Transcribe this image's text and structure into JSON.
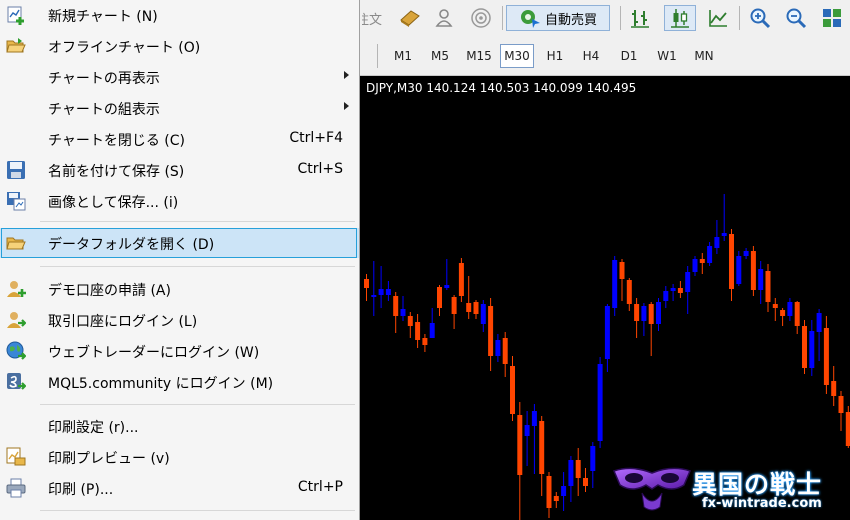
{
  "toolbar": {
    "partial_label": "注文",
    "auto_trade_label": "自動売買"
  },
  "timeframes": [
    {
      "label": "M1"
    },
    {
      "label": "M5"
    },
    {
      "label": "M15"
    },
    {
      "label": "M30",
      "active": true
    },
    {
      "label": "H1"
    },
    {
      "label": "H4"
    },
    {
      "label": "D1"
    },
    {
      "label": "W1"
    },
    {
      "label": "MN"
    }
  ],
  "chart": {
    "header_text": "DJPY,M30  140.124 140.503 140.099 140.495",
    "bull_color": "#0000ff",
    "bear_color": "#ff4500",
    "background": "#000000"
  },
  "chart_data": {
    "type": "candlestick",
    "symbol_fragment": "DJPY",
    "timeframe": "M30",
    "ohlc_last": {
      "open": 140.124,
      "high": 140.503,
      "low": 140.099,
      "close": 140.495
    },
    "candles": [
      [
        203,
        212,
        198,
        225
      ],
      [
        221,
        219,
        185,
        240
      ],
      [
        219,
        213,
        190,
        232
      ],
      [
        219,
        213,
        205,
        225
      ],
      [
        220,
        240,
        216,
        257
      ],
      [
        240,
        233,
        220,
        245
      ],
      [
        240,
        250,
        236,
        262
      ],
      [
        246,
        264,
        238,
        272
      ],
      [
        262,
        269,
        258,
        276
      ],
      [
        262,
        247,
        232,
        253
      ],
      [
        211,
        232,
        209,
        240
      ],
      [
        212,
        209,
        183,
        214
      ],
      [
        221,
        238,
        219,
        253
      ],
      [
        187,
        220,
        182,
        226
      ],
      [
        227,
        236,
        200,
        243
      ],
      [
        226,
        238,
        224,
        243
      ],
      [
        248,
        228,
        224,
        256
      ],
      [
        230,
        280,
        222,
        295
      ],
      [
        280,
        264,
        258,
        286
      ],
      [
        262,
        288,
        256,
        301
      ],
      [
        290,
        338,
        280,
        345
      ],
      [
        339,
        399,
        326,
        448
      ],
      [
        360,
        349,
        335,
        390
      ],
      [
        350,
        335,
        328,
        398
      ],
      [
        345,
        398,
        340,
        420
      ],
      [
        400,
        432,
        396,
        442
      ],
      [
        420,
        425,
        416,
        432
      ],
      [
        420,
        410,
        396,
        435
      ],
      [
        410,
        384,
        380,
        426
      ],
      [
        384,
        402,
        372,
        420
      ],
      [
        402,
        410,
        392,
        416
      ],
      [
        395,
        370,
        366,
        412
      ],
      [
        365,
        288,
        281,
        372
      ],
      [
        283,
        230,
        228,
        296
      ],
      [
        232,
        184,
        180,
        240
      ],
      [
        186,
        203,
        183,
        225
      ],
      [
        204,
        228,
        202,
        235
      ],
      [
        228,
        245,
        222,
        262
      ],
      [
        245,
        230,
        227,
        260
      ],
      [
        228,
        248,
        226,
        280
      ],
      [
        248,
        226,
        222,
        255
      ],
      [
        225,
        215,
        210,
        232
      ],
      [
        215,
        212,
        208,
        225
      ],
      [
        212,
        217,
        205,
        222
      ],
      [
        216,
        196,
        190,
        238
      ],
      [
        196,
        183,
        180,
        200
      ],
      [
        183,
        187,
        177,
        198
      ],
      [
        187,
        170,
        166,
        190
      ],
      [
        172,
        161,
        144,
        178
      ],
      [
        160,
        157,
        118,
        165
      ],
      [
        158,
        213,
        153,
        225
      ],
      [
        208,
        180,
        175,
        210
      ],
      [
        180,
        175,
        172,
        183
      ],
      [
        175,
        214,
        170,
        220
      ],
      [
        214,
        193,
        185,
        228
      ],
      [
        195,
        226,
        188,
        236
      ],
      [
        228,
        232,
        222,
        245
      ],
      [
        234,
        240,
        232,
        250
      ],
      [
        240,
        226,
        222,
        245
      ],
      [
        226,
        250,
        225,
        258
      ],
      [
        250,
        292,
        244,
        298
      ],
      [
        292,
        255,
        244,
        300
      ],
      [
        256,
        237,
        233,
        285
      ],
      [
        252,
        309,
        240,
        318
      ],
      [
        305,
        320,
        290,
        330
      ],
      [
        320,
        337,
        315,
        355
      ],
      [
        336,
        370,
        330,
        372
      ],
      [
        336,
        322,
        314,
        347
      ]
    ]
  },
  "menu": {
    "items": [
      {
        "id": "new-chart",
        "label": "新規チャート (N)",
        "icon": "new-chart-icon"
      },
      {
        "id": "offline-chart",
        "label": "オフラインチャート (O)",
        "icon": "open-folder-icon"
      },
      {
        "id": "chart-redisplay",
        "label": "チャートの再表示",
        "submenu": true
      },
      {
        "id": "chart-arrange",
        "label": "チャートの組表示",
        "submenu": true
      },
      {
        "id": "close-chart",
        "label": "チャートを閉じる (C)",
        "shortcut": "Ctrl+F4"
      },
      {
        "id": "save-as",
        "label": "名前を付けて保存 (S)",
        "shortcut": "Ctrl+S",
        "icon": "floppy-disk-icon"
      },
      {
        "id": "save-as-image",
        "label": "画像として保存... (i)",
        "icon": "save-image-icon"
      },
      {
        "id": "open-data-folder",
        "label": "データフォルダを開く (D)",
        "icon": "open-folder-icon",
        "highlighted": true
      },
      {
        "id": "demo-account",
        "label": "デモ口座の申請 (A)",
        "icon": "add-user-icon"
      },
      {
        "id": "login-trade-account",
        "label": "取引口座にログイン (L)",
        "icon": "user-login-icon"
      },
      {
        "id": "login-web-trader",
        "label": "ウェブトレーダーにログイン (W)",
        "icon": "globe-icon"
      },
      {
        "id": "login-mql5",
        "label": "MQL5.community にログイン (M)",
        "icon": "mql5-login-icon"
      },
      {
        "id": "print-setup",
        "label": "印刷設定 (r)..."
      },
      {
        "id": "print-preview",
        "label": "印刷プレビュー (v)",
        "icon": "print-preview-icon"
      },
      {
        "id": "print",
        "label": "印刷 (P)...",
        "shortcut": "Ctrl+P",
        "icon": "printer-icon"
      }
    ]
  },
  "watermark": {
    "title": "異国の戦士",
    "url": "fx-wintrade.com"
  }
}
